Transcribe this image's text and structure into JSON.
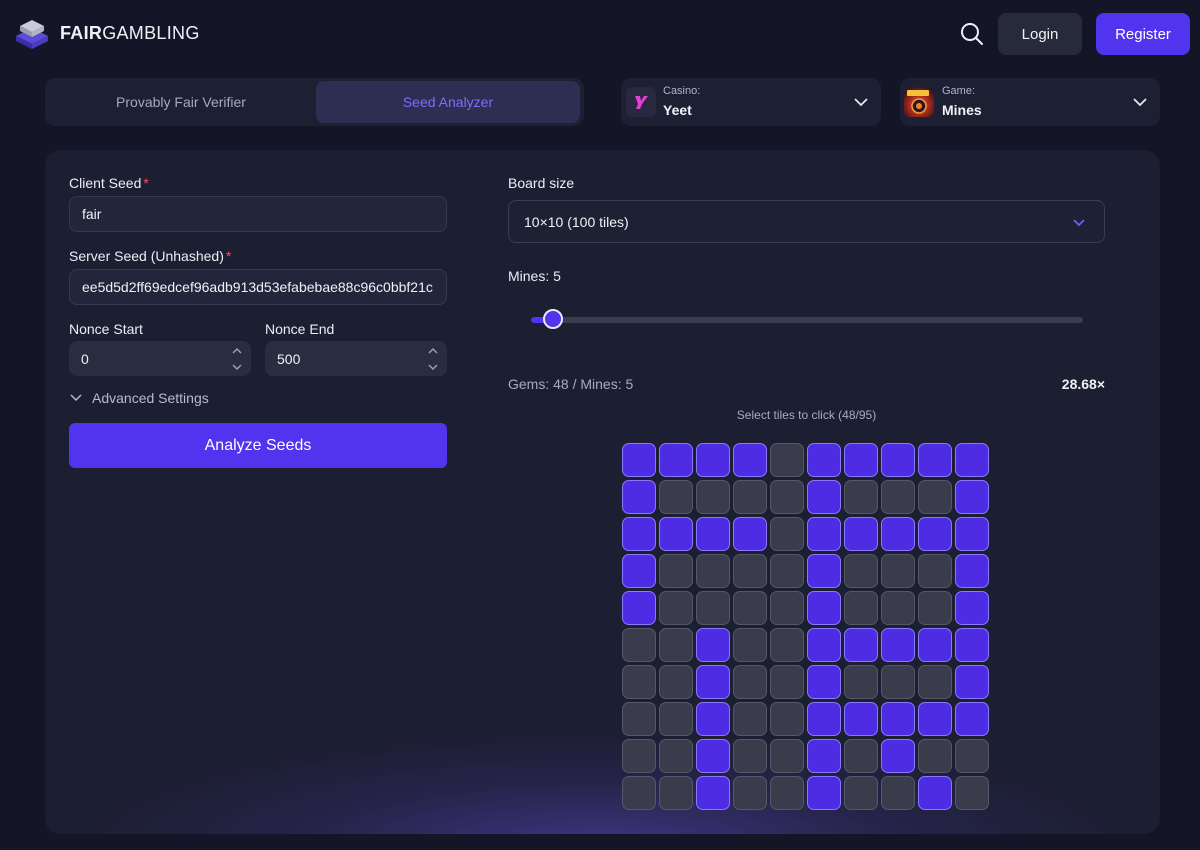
{
  "brand": {
    "name_bold": "FAIR",
    "name_rest": "GAMBLING"
  },
  "header": {
    "login_label": "Login",
    "register_label": "Register",
    "search_icon": "search-icon"
  },
  "tabs": [
    {
      "label": "Provably Fair Verifier",
      "active": false
    },
    {
      "label": "Seed Analyzer",
      "active": true
    }
  ],
  "casino_select": {
    "label": "Casino:",
    "value": "Yeet",
    "icon": "yeet-logo-icon"
  },
  "game_select": {
    "label": "Game:",
    "value": "Mines",
    "icon": "mines-game-icon"
  },
  "form": {
    "client_seed_label": "Client Seed",
    "client_seed_value": "fair",
    "server_seed_label": "Server Seed (Unhashed)",
    "server_seed_value": "ee5d5d2ff69edcef96adb913d53efabebae88c96c0bbf21c",
    "required_marker": "*",
    "nonce_start_label": "Nonce Start",
    "nonce_start_value": "0",
    "nonce_end_label": "Nonce End",
    "nonce_end_value": "500",
    "advanced_label": "Advanced Settings",
    "analyze_label": "Analyze Seeds"
  },
  "board": {
    "size_label": "Board size",
    "size_value": "10×10 (100 tiles)",
    "mines_label": "Mines: 5",
    "mines_value": 5,
    "slider_fraction": 0.04,
    "gems_text": "Gems: 48 / Mines: 5",
    "multiplier": "28.68×",
    "select_hint": "Select tiles to click (48/95)"
  },
  "colors": {
    "accent": "#5233ee",
    "tile_selected": "#4d2ce3",
    "tile_unselected": "#3a3c4b",
    "background": "#141628"
  },
  "tile_rows": [
    "1111011111",
    "1000010001",
    "1111011111",
    "1000010001",
    "1000010001",
    "0010011111",
    "0010010001",
    "0010011111",
    "0010010100",
    "0010010010"
  ]
}
